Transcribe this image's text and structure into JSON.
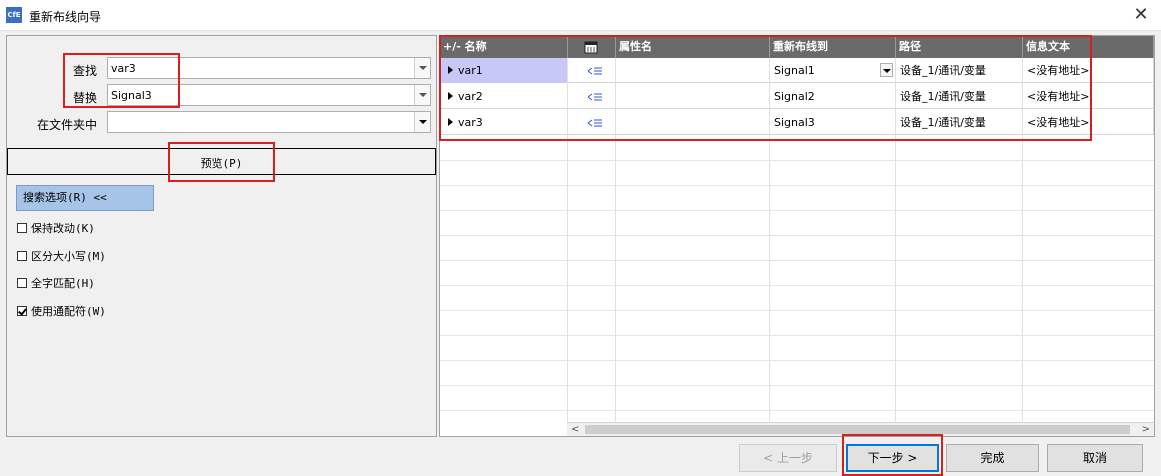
{
  "window": {
    "title": "重新布线向导",
    "icon_text": "CfE"
  },
  "search": {
    "find_label": "查找",
    "find_value": "var3",
    "replace_label": "替换",
    "replace_value": "Signal3",
    "folder_label": "在文件夹中",
    "folder_value": ""
  },
  "preview_label": "预览(P)",
  "search_options_label": "搜索选项(R) <<",
  "options": [
    {
      "label": "保持改动(K)",
      "checked": false
    },
    {
      "label": "区分大小写(M)",
      "checked": false
    },
    {
      "label": "全字匹配(H)",
      "checked": false
    },
    {
      "label": "使用通配符(W)",
      "checked": true
    }
  ],
  "grid": {
    "columns": [
      "+/- 名称",
      "",
      "属性名",
      "重新布线到",
      "路径",
      "信息文本"
    ],
    "rows": [
      {
        "name": "var1",
        "property": "",
        "rewire_to": "Signal1",
        "path": "设备_1/通讯/变量",
        "info": "<没有地址>"
      },
      {
        "name": "var2",
        "property": "",
        "rewire_to": "Signal2",
        "path": "设备_1/通讯/变量",
        "info": "<没有地址>"
      },
      {
        "name": "var3",
        "property": "",
        "rewire_to": "Signal3",
        "path": "设备_1/通讯/变量",
        "info": "<没有地址>"
      }
    ]
  },
  "buttons": {
    "prev": "< 上一步",
    "next": "下一步 >",
    "finish": "完成",
    "cancel": "取消"
  },
  "colors": {
    "highlight": "#d42020",
    "header_bg": "#6a6a6a",
    "selected_cell": "#c8c8f8",
    "options_button": "#a5c4e8"
  }
}
